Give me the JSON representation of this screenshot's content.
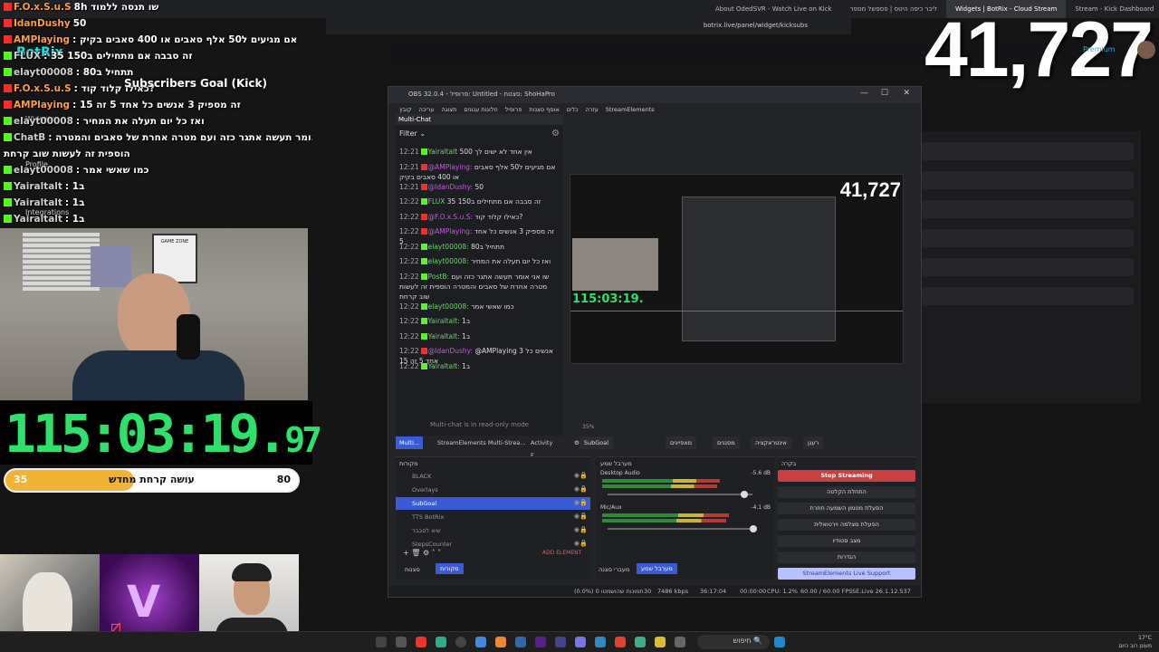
{
  "browser": {
    "tabs": [
      {
        "label": "About OdedSVR - Watch Live on Kick"
      },
      {
        "label": "ליבר כיפה היטס | פספשל מספר"
      },
      {
        "label": "Widgets | BotRix - Cloud Stream"
      },
      {
        "label": "Stream - Kick Dashboard"
      }
    ],
    "url": "botrix.live/panel/widget/kicksubs"
  },
  "background": {
    "brand": "BotRix",
    "sidebar": [
      "Widgets",
      "Profile",
      "Integrations"
    ],
    "premium": "Premium"
  },
  "overlay": {
    "goal_title": "Subscribers Goal (Kick)",
    "counter": "41,727",
    "timer_main": "115:03:19.",
    "timer_cs": "97",
    "progress": {
      "current": "35",
      "target": "80",
      "label": "עושה קרחת מחדש",
      "fraction": 0.44
    },
    "chat": [
      {
        "user": "F.O.x.S.u.S",
        "msg": "8h שו תנסה ללמוד",
        "src": "yt"
      },
      {
        "user": "IdanDushy",
        "msg": "50",
        "src": "yt"
      },
      {
        "user": "AMPlaying",
        "msg": ": אם מגיעים ל50 אלף סאבים או 400 סאבים בקיק",
        "src": "yt"
      },
      {
        "user": "FLUX",
        "msg": ": זה סבבה אם מתחילים ב150 35",
        "src": "kick"
      },
      {
        "user": "elayt00008",
        "msg": ": תתחיל ב80",
        "src": "kick"
      },
      {
        "user": "F.O.x.S.u.S",
        "msg": ": כאילו קלוד קוד?",
        "src": "yt"
      },
      {
        "user": "AMPlaying",
        "msg": ": זה מספיק 3 אנשים כל אחד 5 זה 15",
        "src": "yt"
      },
      {
        "user": "elayt00008",
        "msg": ": ואז כל יום תעלה את המחיר",
        "src": "kick"
      },
      {
        "user": "ChatB",
        "msg": ": שו אני אומר תעשה אתגר כזה ועם מטרה אחרת של סאבים והמטרה",
        "src": "kick"
      },
      {
        "user": "",
        "msg": "הוספית זה לעשות שוב קרחת",
        "src": ""
      },
      {
        "user": "elayt00008",
        "msg": ": כמו שאשי אמר",
        "src": "kick"
      },
      {
        "user": "Yairaltalt",
        "msg": ": ב1",
        "src": "kick"
      },
      {
        "user": "Yairaltalt",
        "msg": ": ב1",
        "src": "kick"
      },
      {
        "user": "Yairaltalt",
        "msg": ": ב1",
        "src": "kick"
      }
    ]
  },
  "obs": {
    "title": "OBS 32.0.4 - פרופיל: Untitled - סצנות: ShoHaPro",
    "menu": [
      "קובץ",
      "עריכה",
      "תצוגה",
      "חלונות עגונים",
      "פרופיל",
      "אוסף סצנות",
      "כלים",
      "עזרה",
      "StreamElements"
    ],
    "multichat": {
      "header": "Multi-Chat",
      "filter": "Filter",
      "readonly": "Multi-chat is in read-only mode",
      "messages": [
        {
          "t": "12:21",
          "user": "Yairaltalt",
          "msg": "אין אחד לא ישים לך 500",
          "src": "kick"
        },
        {
          "t": "12:21",
          "user": "@AMPlaying:",
          "msg": "אם מגיעים ל50 אלף סאבים או 400 סאבים בקיק",
          "src": "yt"
        },
        {
          "t": "12:21",
          "user": "@IdanDushy:",
          "msg": "50",
          "src": "yt"
        },
        {
          "t": "12:22",
          "user": "FLUX",
          "msg": "זה סבבה אם מתחילים ב150 35",
          "src": "kick"
        },
        {
          "t": "12:22",
          "user": "@F.O.x.S.u.S:",
          "msg": "כאילו קלוד קוד?",
          "src": "yt"
        },
        {
          "t": "12:22",
          "user": "@AMPlaying:",
          "msg": "זה מספיק 3 אנשים כל אחד 5",
          "src": "yt"
        },
        {
          "t": "12:22",
          "user": "elayt00008:",
          "msg": "תתחיל ב80",
          "src": "kick"
        },
        {
          "t": "12:22",
          "user": "elayt00008:",
          "msg": "ואז כל יום תעלה את המחיר",
          "src": "kick"
        },
        {
          "t": "12:22",
          "user": "PostB:",
          "msg": "שו אני אומר תעשה אתגר כזה ועם מטרה אחרת של סאבים והמטרה הוספית זה לעשות שוב קרחת",
          "src": "kick"
        },
        {
          "t": "12:22",
          "user": "elayt00008:",
          "msg": "כמו שאשי אמר",
          "src": "kick"
        },
        {
          "t": "12:22",
          "user": "Yairaltalt:",
          "msg": "ב1",
          "src": "kick"
        },
        {
          "t": "12:22",
          "user": "Yairaltalt:",
          "msg": "ב1",
          "src": "kick"
        },
        {
          "t": "12:22",
          "user": "@IdanDushy:",
          "msg": "@AMPlaying 3 אנשים כל אחד 5 זה 15",
          "src": "yt"
        },
        {
          "t": "12:22",
          "user": "Yairaltalt:",
          "msg": "ב1",
          "src": "kick"
        }
      ]
    },
    "dock_tabs": [
      "Multi...",
      "StreamElements Multi-Strea...",
      "Activity F..."
    ],
    "scene_name": "SubGoal",
    "scene_buttons": [
      "מאפיינים",
      "מסננים",
      "אינטראקציה",
      "רענן"
    ],
    "zoom_text": "35%",
    "sources_header": "מקורות",
    "sources": [
      {
        "name": "BLACK",
        "selected": false
      },
      {
        "name": "Overlays",
        "selected": false
      },
      {
        "name": "SubGoal",
        "selected": true
      },
      {
        "name": "TTS BotRix",
        "selected": false
      },
      {
        "name": "שיא לסבבר",
        "selected": false
      },
      {
        "name": "StepsCounter",
        "selected": false
      }
    ],
    "add_element": "ADD ELEMENT",
    "bottom_tabs_left": [
      "סצנות",
      "מקורות"
    ],
    "mixer_header": "מערבל שמע",
    "mixer": [
      {
        "name": "Desktop Audio",
        "db": "-5.6 dB",
        "level": 0.72
      },
      {
        "name": "Mic/Aux",
        "db": "-4.1 dB",
        "level": 0.78
      }
    ],
    "bottom_tabs_mid": [
      "מעברי סצנה",
      "מערבל שמע"
    ],
    "controls_header": "בקרה",
    "controls": [
      "Stop Streaming",
      "התחלת הקלטה",
      "הפעלת מטמון השמעה חוזרת",
      "הפעלת מצלמה וירטואלית",
      "מצב סטודיו",
      "הגדרות",
      "StreamElements Live Support"
    ],
    "status": {
      "frames": "(0.0%) 0 תמונות שהושמטו",
      "dropped": "30",
      "kbps": "7486 kbps",
      "time": "00:00:00",
      "live": "36:17:04",
      "cpu": "CPU: 1.2%",
      "fps": "60.00 / 60.00 FPS",
      "version": "SE.Live 26.1.12.537"
    }
  },
  "taskbar": {
    "search": "חיפוש",
    "temp": "17°C",
    "weather": "מעונן רוב היום"
  }
}
